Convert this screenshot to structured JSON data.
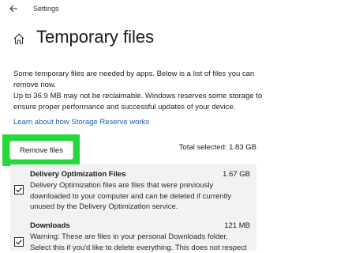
{
  "window": {
    "app_title": "Settings"
  },
  "page": {
    "title": "Temporary files"
  },
  "description": {
    "paragraph1": "Some temporary files are needed by apps. Below is a list of files you can remove now.",
    "paragraph2": "Up to 36.9 MB may not be reclaimable. Windows reserves some storage to ensure proper performance and successful updates of your device.",
    "link": "Learn about how Storage Reserve works"
  },
  "actions": {
    "remove_label": "Remove files",
    "total_selected": "Total selected: 1.83 GB",
    "highlight_color": "#26d93a"
  },
  "items": [
    {
      "name": "Delivery Optimization Files",
      "size": "1.67 GB",
      "description": "Delivery Optimization files are files that were previously downloaded to your computer and can be deleted if currently unused by the Delivery Optimization service.",
      "checked": true
    },
    {
      "name": "Downloads",
      "size": "121 MB",
      "description": "Warning: These are files in your personal Downloads folder. Select this if you'd like to delete everything. This does not respect",
      "checked": true
    }
  ]
}
